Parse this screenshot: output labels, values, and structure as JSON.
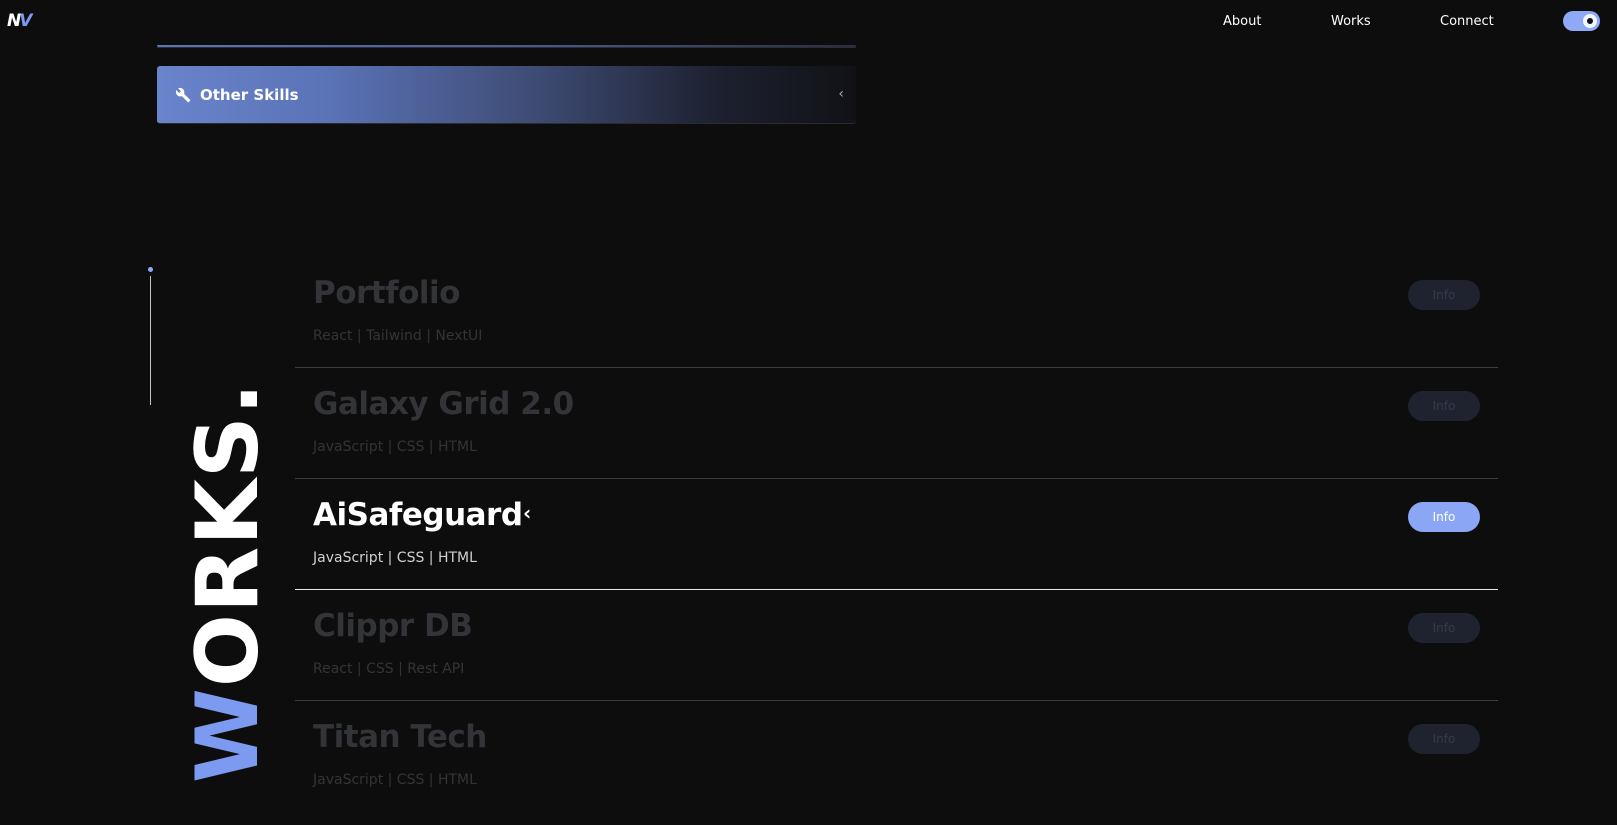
{
  "header": {
    "logo": {
      "part1": "N",
      "part2": "V"
    },
    "nav": [
      {
        "label": "About"
      },
      {
        "label": "Works"
      },
      {
        "label": "Connect"
      }
    ],
    "theme_toggle_icon": "moon-toggle-icon"
  },
  "skills": {
    "other_label": "Other Skills",
    "other_icon": "wrench-icon",
    "chevron_icon": "chevron-left-icon"
  },
  "works": {
    "title_first": "W",
    "title_rest": "ORKS.",
    "projects": [
      {
        "name": "Portfolio",
        "tags": "React | Tailwind | NextUI",
        "button": "Info",
        "active": false
      },
      {
        "name": "Galaxy Grid 2.0",
        "tags": "JavaScript | CSS | HTML",
        "button": "Info",
        "active": false
      },
      {
        "name": "AiSafeguard",
        "tags": "JavaScript | CSS | HTML",
        "button": "Info",
        "active": true
      },
      {
        "name": "Clippr DB",
        "tags": "React | CSS | Rest API",
        "button": "Info",
        "active": false
      },
      {
        "name": "Titan Tech",
        "tags": "JavaScript | CSS | HTML",
        "button": "Info",
        "active": false
      }
    ]
  },
  "colors": {
    "accent": "#7b9af0",
    "background": "#0d0d0e",
    "active_button": "#8aa6f4"
  }
}
